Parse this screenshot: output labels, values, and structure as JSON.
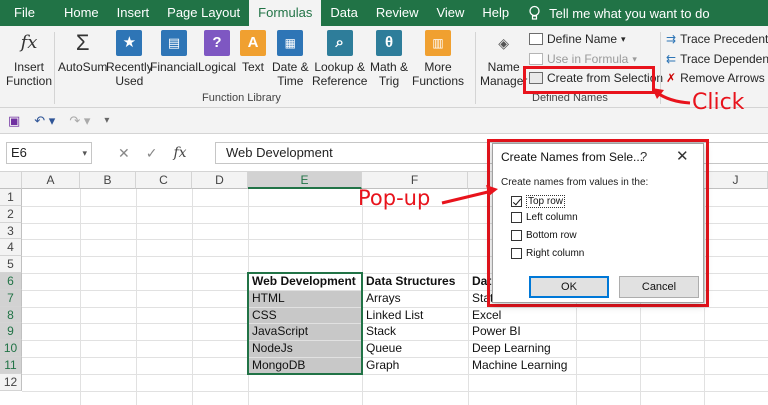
{
  "tabs": [
    {
      "label": "File",
      "active": false
    },
    {
      "label": "Home",
      "active": false
    },
    {
      "label": "Insert",
      "active": false
    },
    {
      "label": "Page Layout",
      "active": false
    },
    {
      "label": "Formulas",
      "active": true
    },
    {
      "label": "Data",
      "active": false
    },
    {
      "label": "Review",
      "active": false
    },
    {
      "label": "View",
      "active": false
    },
    {
      "label": "Help",
      "active": false
    }
  ],
  "tell_me": "Tell me what you want to do",
  "ribbon": {
    "insert_function": {
      "line1": "Insert",
      "line2": "Function"
    },
    "autosum": {
      "line1": "AutoSum",
      "line2": ""
    },
    "recently_used": {
      "line1": "Recently",
      "line2": "Used"
    },
    "financial": {
      "line1": "Financial",
      "line2": ""
    },
    "logical": {
      "line1": "Logical",
      "line2": ""
    },
    "text": {
      "line1": "Text",
      "line2": ""
    },
    "date_time": {
      "line1": "Date &",
      "line2": "Time"
    },
    "lookup": {
      "line1": "Lookup &",
      "line2": "Reference"
    },
    "math": {
      "line1": "Math &",
      "line2": "Trig"
    },
    "more": {
      "line1": "More",
      "line2": "Functions"
    },
    "function_library_label": "Function Library",
    "name_manager": {
      "line1": "Name",
      "line2": "Manager"
    },
    "define_name": "Define Name",
    "use_in_formula": "Use in Formula",
    "create_from_selection": "Create from Selection",
    "defined_names_label": "Defined Names",
    "trace_precedents": "Trace Precedents",
    "trace_dependents": "Trace Dependents",
    "remove_arrows": "Remove Arrows",
    "icons": {
      "insert_function": "fx",
      "autosum": "Σ",
      "logical": "?",
      "text": "A",
      "math": "θ"
    },
    "colors": {
      "blue": "#2e75b6",
      "purple": "#7e57c2",
      "orange": "#f0a030",
      "teal": "#2e7d9a",
      "green_tab": "#217346"
    }
  },
  "formula_bar": {
    "name_box": "E6",
    "fx": "fx",
    "content": "Web Development"
  },
  "columns": [
    "A",
    "B",
    "C",
    "D",
    "E",
    "F",
    "G",
    "H",
    "I",
    "J"
  ],
  "rows": [
    "1",
    "2",
    "3",
    "4",
    "5",
    "6",
    "7",
    "8",
    "9",
    "10",
    "11",
    "12"
  ],
  "cells": {
    "E6": "Web Development",
    "F6": "Data Structures",
    "G6": "Dat",
    "E7": "HTML",
    "F7": "Arrays",
    "G7": "Stat",
    "E8": "CSS",
    "F8": "Linked List",
    "G8": "Excel",
    "E9": "JavaScript",
    "F9": "Stack",
    "G9": "Power BI",
    "E10": "NodeJs",
    "F10": "Queue",
    "G10": "Deep Learning",
    "E11": "MongoDB",
    "F11": "Graph",
    "G11": "Machine Learning"
  },
  "dialog": {
    "title": "Create Names from Sele...",
    "help": "?",
    "close": "✕",
    "subtitle": "Create names from values in the:",
    "options": [
      {
        "label": "Top row",
        "checked": true
      },
      {
        "label": "Left column",
        "checked": false
      },
      {
        "label": "Bottom row",
        "checked": false
      },
      {
        "label": "Right column",
        "checked": false
      }
    ],
    "ok": "OK",
    "cancel": "Cancel"
  },
  "annotations": {
    "click": "Click",
    "popup": "Pop-up",
    "color": "#e8131c"
  }
}
